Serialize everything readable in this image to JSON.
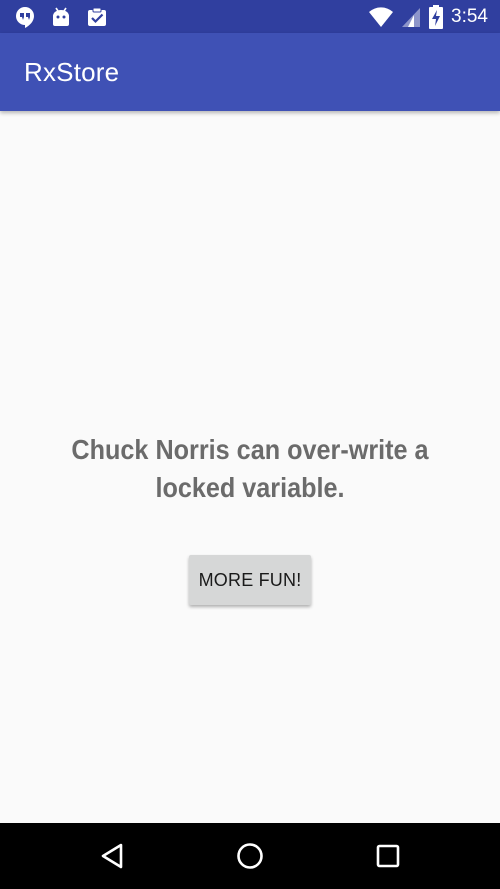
{
  "status_bar": {
    "time": "3:54",
    "left_icons": [
      "hangouts-icon",
      "android-icon",
      "clipboard-check-icon"
    ],
    "right_icons": [
      "wifi-icon",
      "cell-signal-icon",
      "battery-charging-icon"
    ],
    "color": "#303f9f"
  },
  "app_bar": {
    "title": "RxStore",
    "color": "#3f51b5"
  },
  "main": {
    "joke_text": "Chuck Norris can over-write a locked variable.",
    "more_button_label": "MORE FUN!"
  },
  "nav_bar": {
    "icons": [
      "back-icon",
      "home-icon",
      "recents-icon"
    ]
  }
}
